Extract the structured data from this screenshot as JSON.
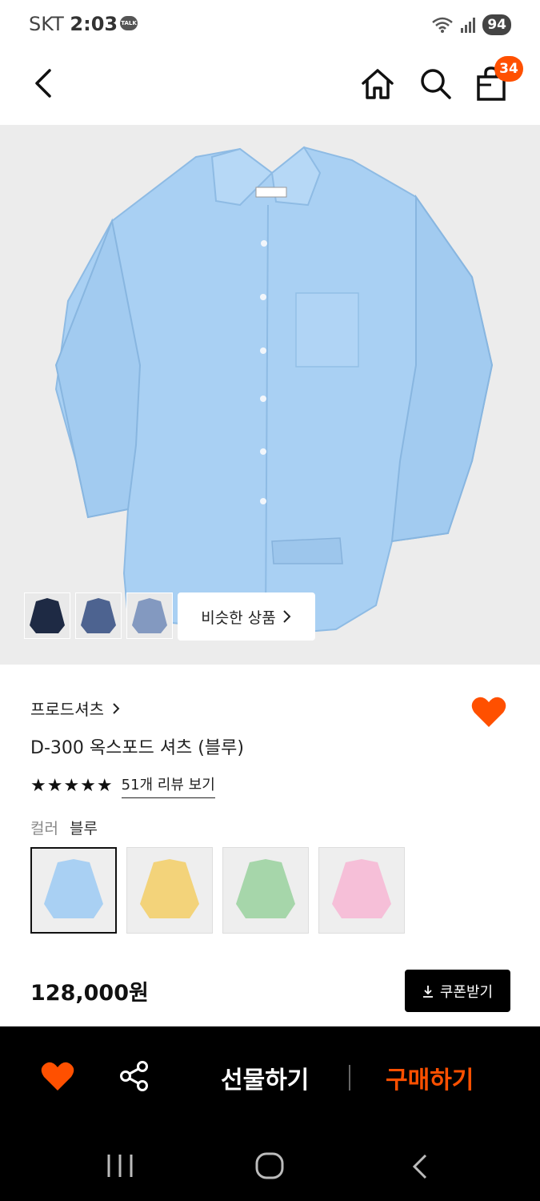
{
  "status_bar": {
    "carrier": "SKT",
    "time": "2:03",
    "talk_badge": "TALK",
    "battery": "94"
  },
  "header": {
    "cart_count": "34"
  },
  "gallery": {
    "similar_label": "비슷한 상품",
    "thumbnails": [
      "navy-shirt",
      "denim-shirt",
      "chambray-shirt"
    ]
  },
  "product": {
    "brand": "프로드셔츠",
    "title": "D-300 옥스포드 셔츠 (블루)",
    "rating_stars": "★★★★★",
    "reviews_label": "51개 리뷰 보기",
    "color_label": "컬러",
    "color_value": "블루",
    "swatches": [
      "blue",
      "yellow",
      "green",
      "pink"
    ],
    "price": "128,000원",
    "coupon_label": "쿠폰받기"
  },
  "actions": {
    "gift_label": "선물하기",
    "buy_label": "구매하기"
  },
  "colors": {
    "accent": "#ff5000",
    "shirt_blue": "#a9d0f3",
    "background_gray": "#ececec"
  }
}
